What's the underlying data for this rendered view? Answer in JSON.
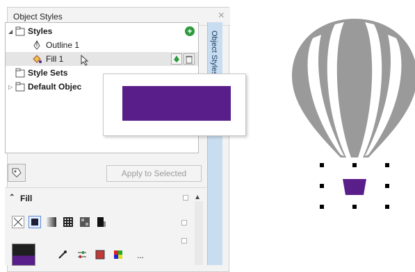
{
  "panel": {
    "title": "Object Styles",
    "close_glyph": "×",
    "side_tab_label": "Object Styles"
  },
  "tree": {
    "items": [
      {
        "label": "Styles",
        "bold": true,
        "icon": "styles-folder-icon"
      },
      {
        "label": "Outline 1",
        "bold": false,
        "icon": "pen-nib-icon"
      },
      {
        "label": "Fill 1",
        "bold": false,
        "icon": "paint-bucket-icon"
      },
      {
        "label": "Style Sets",
        "bold": true,
        "icon": "style-sets-folder-icon"
      },
      {
        "label": "Default Objec",
        "bold": true,
        "icon": "default-objects-folder-icon"
      }
    ],
    "add_glyph": "+"
  },
  "popup": {
    "swatch_color": "#5a1e8a"
  },
  "toolbar": {
    "apply_label": "Apply to Selected"
  },
  "fill": {
    "header": "Fill",
    "chevron": "⌃",
    "more_label": "..."
  },
  "colors": {
    "purple": "#5a1e8a",
    "balloon_gray": "#9a9a9a",
    "accent_green": "#2e9a3e"
  }
}
